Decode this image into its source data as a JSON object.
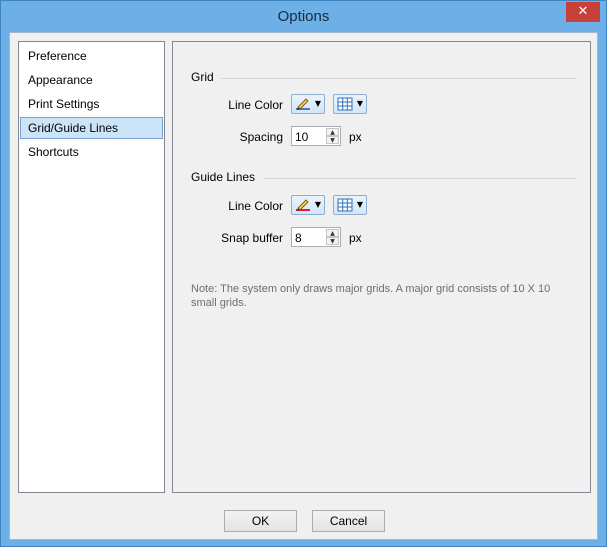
{
  "window": {
    "title": "Options",
    "close_glyph": "✕"
  },
  "nav": {
    "items": [
      {
        "label": "Preference"
      },
      {
        "label": "Appearance"
      },
      {
        "label": "Print Settings"
      },
      {
        "label": "Grid/Guide Lines",
        "selected": true
      },
      {
        "label": "Shortcuts"
      }
    ]
  },
  "grid": {
    "section_title": "Grid",
    "line_color_label": "Line Color",
    "spacing_label": "Spacing",
    "spacing_value": "10",
    "spacing_unit": "px"
  },
  "guide": {
    "section_title": "Guide Lines",
    "line_color_label": "Line Color",
    "snap_label": "Snap buffer",
    "snap_value": "8",
    "snap_unit": "px"
  },
  "note": "Note: The system only draws major grids. A major grid consists of 10 X 10 small grids.",
  "footer": {
    "ok_label": "OK",
    "cancel_label": "Cancel"
  },
  "icons": {
    "pencil": "pencil-icon",
    "grid": "grid-icon",
    "dropdown": "▼",
    "spin_up": "▲",
    "spin_down": "▼"
  },
  "colors": {
    "accent": "#6cb0e7",
    "selection": "#cce4f7",
    "guide_underline": "#e0202a"
  }
}
